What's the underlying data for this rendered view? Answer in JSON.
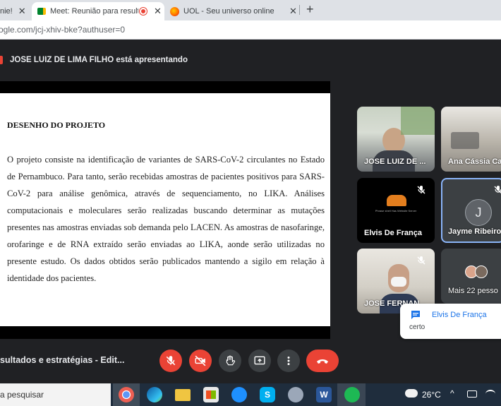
{
  "browser": {
    "tabs": [
      {
        "label": "nie!",
        "active": false
      },
      {
        "label": "Meet: Reunião para resultad",
        "active": true
      },
      {
        "label": "UOL - Seu universo online",
        "active": false
      }
    ],
    "new_tab": "+",
    "close": "✕",
    "url": "ogle.com/jcj-xhiv-bke?authuser=0"
  },
  "meet": {
    "presenting_banner": "JOSE LUIZ DE LIMA FILHO está apresentando",
    "slide": {
      "title": "DESENHO DO PROJETO",
      "body": "O projeto consiste na identificação de variantes de SARS-CoV-2 circulantes no Estado de Pernambuco. Para tanto, serão recebidas amostras de pacientes positivos para SARS-CoV-2 para análise genômica, através de sequenciamento, no LIKA. Análises computacionais e moleculares serão realizadas buscando determinar as mutações presentes nas amostras enviadas sob demanda pelo LACEN. As amostras de nasofaringe, orofaringe e de RNA extraído serão enviadas ao LIKA, aonde serão utilizadas no presente estudo. Os dados obtidos serão publicados mantendo a sigilo em relação à identidade dos pacientes."
    },
    "participants": [
      {
        "name": "JOSE LUIZ DE ..."
      },
      {
        "name": "Ana Cássia Ca"
      },
      {
        "name": "Elvis De França",
        "logo_text": "Phrase shell Has Website Server"
      },
      {
        "name": "Jayme Ribeiro",
        "initial": "J"
      },
      {
        "name": "JOSE FERNAN..."
      },
      {
        "name": "Mais 22 pesso"
      }
    ],
    "chat": {
      "sender": "Elvis De França",
      "message": "certo"
    },
    "meeting_title": "sultados e estratégias - Edit..."
  },
  "taskbar": {
    "search_placeholder": "a pesquisar",
    "weather": "26°C",
    "apps": [
      "chrome",
      "edge",
      "explorer",
      "store",
      "safari",
      "skype",
      "pinball",
      "word",
      "spotify"
    ]
  },
  "colors": {
    "accent_red": "#ea4335",
    "meet_bg": "#202124",
    "blue": "#1a73e8"
  }
}
